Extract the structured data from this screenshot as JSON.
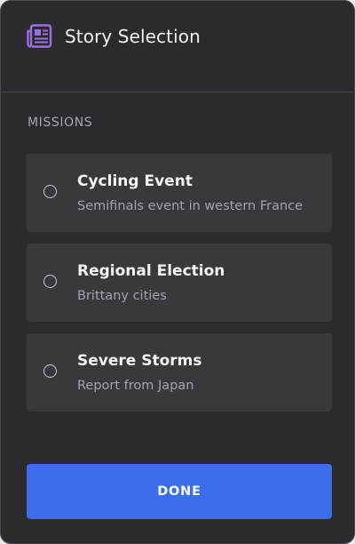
{
  "header": {
    "title": "Story Selection",
    "icon": "newspaper-icon",
    "accent_color": "#9b6fe0"
  },
  "section": {
    "label": "MISSIONS"
  },
  "missions": [
    {
      "title": "Cycling Event",
      "subtitle": "Semifinals event in western France",
      "selected": false
    },
    {
      "title": "Regional Election",
      "subtitle": "Brittany cities",
      "selected": false
    },
    {
      "title": "Severe Storms",
      "subtitle": "Report from Japan",
      "selected": false
    }
  ],
  "footer": {
    "done_label": "DONE",
    "done_color": "#3b6ee8"
  }
}
